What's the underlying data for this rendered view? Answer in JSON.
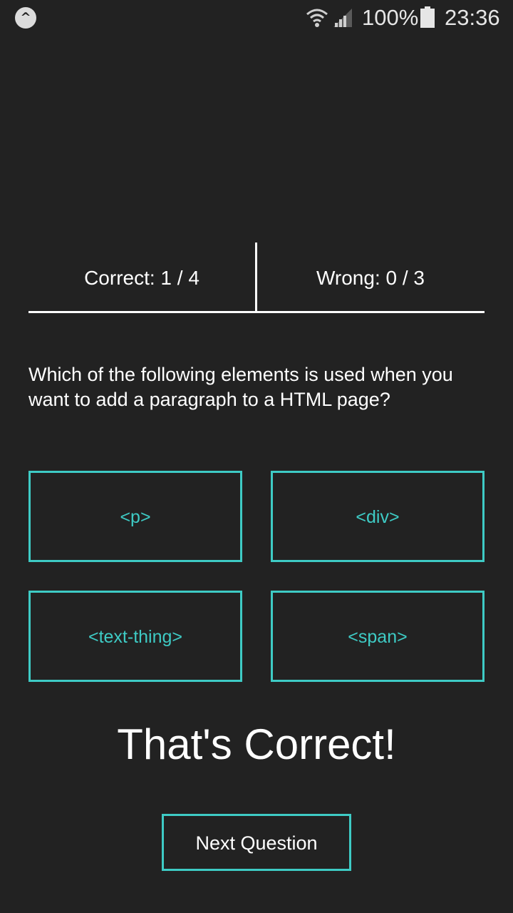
{
  "status_bar": {
    "app_icon": "expo-caret-icon",
    "app_icon_glyph": "^",
    "battery_percent": "100%",
    "time": "23:36"
  },
  "score": {
    "correct_label": "Correct: 1 / 4",
    "wrong_label": "Wrong: 0 / 3"
  },
  "question": {
    "text": "Which of the following elements is used when you want to add a paragraph to a HTML page?"
  },
  "answers": [
    {
      "label": "<p>"
    },
    {
      "label": "<div>"
    },
    {
      "label": "<text-thing>"
    },
    {
      "label": "<span>"
    }
  ],
  "feedback": "That's Correct!",
  "next_button_label": "Next Question",
  "colors": {
    "background": "#222222",
    "accent": "#3ecbc5",
    "text": "#ffffff"
  }
}
